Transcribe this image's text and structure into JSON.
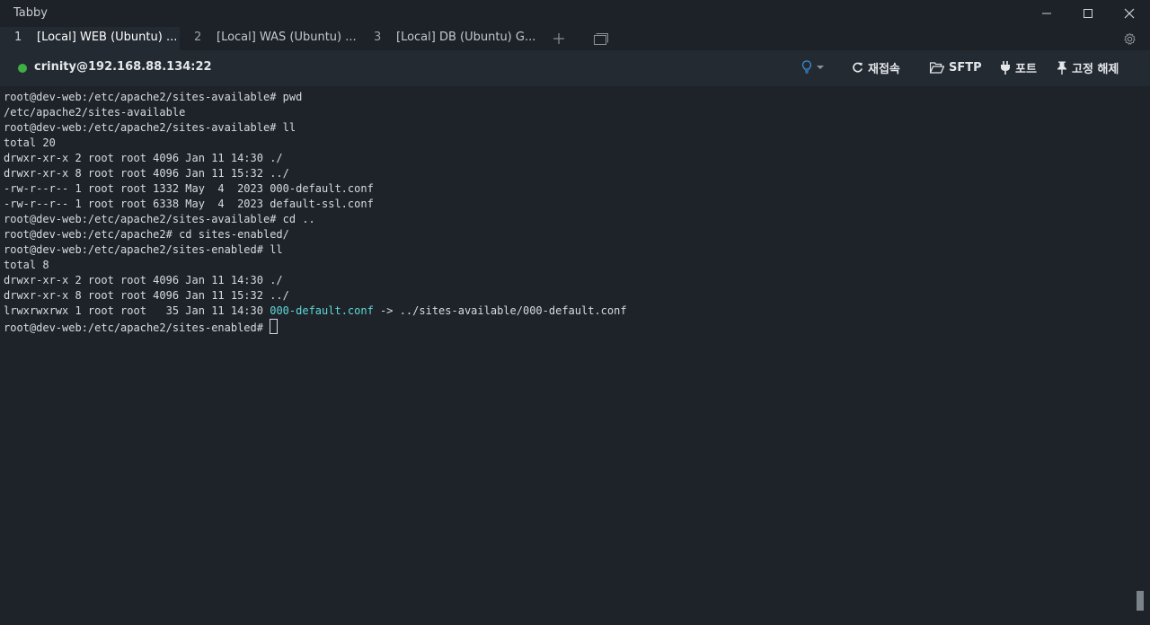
{
  "window": {
    "title": "Tabby"
  },
  "tabs": [
    {
      "num": "1",
      "label": "[Local] WEB (Ubuntu) ...",
      "active": true
    },
    {
      "num": "2",
      "label": "[Local] WAS (Ubuntu) ...",
      "active": false
    },
    {
      "num": "3",
      "label": "[Local] DB (Ubuntu) G...",
      "active": false
    }
  ],
  "connection": {
    "host": "crinity@192.168.88.134:22",
    "status_color": "#3cb043"
  },
  "toolbar": {
    "reconnect_label": "재접속",
    "sftp_label": "SFTP",
    "ports_label": "포트",
    "unpin_label": "고정 해제",
    "accent_color": "#3b8ed8"
  },
  "terminal": {
    "lines": [
      "root@dev-web:/etc/apache2/sites-available# pwd",
      "/etc/apache2/sites-available",
      "root@dev-web:/etc/apache2/sites-available# ll",
      "total 20",
      "drwxr-xr-x 2 root root 4096 Jan 11 14:30 ./",
      "drwxr-xr-x 8 root root 4096 Jan 11 15:32 ../",
      "-rw-r--r-- 1 root root 1332 May  4  2023 000-default.conf",
      "-rw-r--r-- 1 root root 6338 May  4  2023 default-ssl.conf",
      "root@dev-web:/etc/apache2/sites-available# cd ..",
      "root@dev-web:/etc/apache2# cd sites-enabled/",
      "root@dev-web:/etc/apache2/sites-enabled# ll",
      "total 8",
      "drwxr-xr-x 2 root root 4096 Jan 11 14:30 ./",
      "drwxr-xr-x 8 root root 4096 Jan 11 15:32 ../"
    ],
    "symlink_line": {
      "prefix": "lrwxrwxrwx 1 root root   35 Jan 11 14:30 ",
      "link_name": "000-default.conf",
      "suffix": " -> ../sites-available/000-default.conf"
    },
    "prompt": "root@dev-web:/etc/apache2/sites-enabled# "
  }
}
